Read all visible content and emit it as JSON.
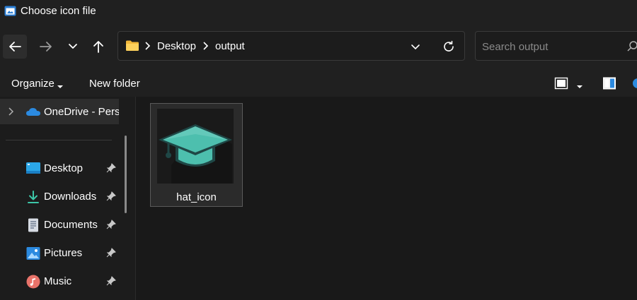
{
  "window": {
    "title": "Choose icon file"
  },
  "nav": {
    "back_icon": "arrow-left-icon",
    "forward_icon": "arrow-right-icon",
    "recent_icon": "chevron-down-icon",
    "up_icon": "arrow-up-icon"
  },
  "address": {
    "folder_icon": "folder-icon",
    "crumbs": [
      "Desktop",
      "output"
    ],
    "dropdown_icon": "chevron-down-icon",
    "refresh_icon": "refresh-icon"
  },
  "search": {
    "placeholder": "Search output",
    "icon": "search-icon"
  },
  "toolbar": {
    "organize_label": "Organize",
    "new_folder_label": "New folder",
    "view_icon": "view-mode-icon",
    "preview_icon": "preview-pane-icon",
    "help_icon": "help-icon"
  },
  "sidebar": {
    "onedrive_label": "OneDrive - Perso",
    "items": [
      {
        "label": "Desktop",
        "icon": "desktop-icon",
        "pinned": true
      },
      {
        "label": "Downloads",
        "icon": "download-icon",
        "pinned": true
      },
      {
        "label": "Documents",
        "icon": "document-icon",
        "pinned": true
      },
      {
        "label": "Pictures",
        "icon": "pictures-icon",
        "pinned": true
      },
      {
        "label": "Music",
        "icon": "music-icon",
        "pinned": true
      }
    ]
  },
  "files": [
    {
      "name": "hat_icon",
      "icon": "graduation-cap-icon",
      "selected": true
    }
  ],
  "colors": {
    "background": "#191919",
    "chrome": "#202020",
    "accent": "#0078d4",
    "cap_teal": "#4dbfae"
  }
}
